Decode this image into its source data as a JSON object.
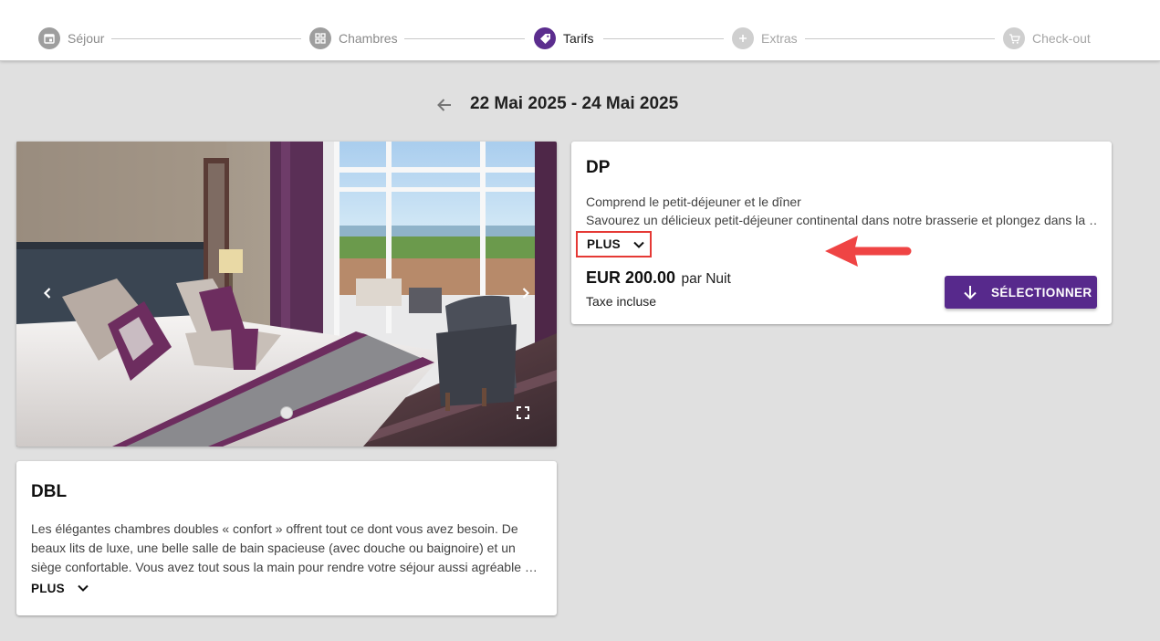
{
  "stepper": {
    "steps": [
      {
        "label": "Séjour",
        "state": "done",
        "icon": "calendar-icon"
      },
      {
        "label": "Chambres",
        "state": "done",
        "icon": "grid-icon"
      },
      {
        "label": "Tarifs",
        "state": "active",
        "icon": "tag-icon"
      },
      {
        "label": "Extras",
        "state": "future",
        "icon": "plus-icon"
      },
      {
        "label": "Check-out",
        "state": "future",
        "icon": "cart-icon"
      }
    ]
  },
  "header": {
    "date_range": "22 Mai 2025 - 24 Mai 2025",
    "back_icon": "arrow-left-icon"
  },
  "gallery": {
    "prev_icon": "chevron-left-icon",
    "next_icon": "chevron-right-icon",
    "fullscreen_icon": "fullscreen-icon",
    "image_count": 1,
    "active_index": 0
  },
  "room": {
    "code": "DBL",
    "description_lines": [
      "Les élégantes chambres doubles « confort » offrent tout ce dont vous avez besoin. De",
      "beaux lits de luxe, une belle salle de bain spacieuse (avec douche ou baignoire) et un",
      "siège confortable. Vous avez tout sous la main pour rendre votre séjour aussi agréable …"
    ],
    "more_label": "PLUS"
  },
  "rate": {
    "code": "DP",
    "description_lines": [
      "Comprend le petit-déjeuner et le dîner",
      "Savourez un délicieux petit-déjeuner continental dans notre brasserie et plongez dans la …"
    ],
    "more_label": "PLUS",
    "price": "EUR 200.00",
    "per_unit": "par Nuit",
    "tax_note": "Taxe incluse",
    "select_label": "SÉLECTIONNER"
  },
  "colors": {
    "accent": "#57298c",
    "step_active": "#5b2d8e",
    "annotation": "#e53935",
    "background": "#e0e0e0"
  }
}
